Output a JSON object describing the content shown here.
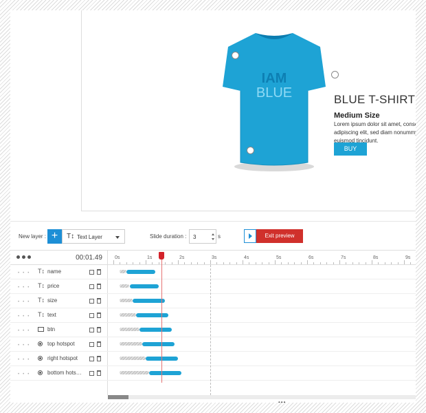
{
  "slide": {
    "shirt_text_line1": "IAM",
    "shirt_text_line2": "BLUE",
    "title": "BLUE T-SHIRT /",
    "subtitle": "Medium Size",
    "description_lines": [
      "Lorem ipsum dolor sit amet, consec",
      "adipiscing elit, sed diam nonummy",
      "euismod tincidunt."
    ],
    "button_label": "BUY"
  },
  "toolbar": {
    "new_layer_label": "New layer :",
    "add_button_glyph": "+",
    "layer_type_glyph": "T↕",
    "layer_type_value": "Text Layer",
    "slide_duration_label": "Slide duration :",
    "slide_duration_value": "3",
    "slide_duration_unit": "s",
    "exit_preview_label": "Exit preview"
  },
  "timeline": {
    "current_time": "00:01.49",
    "ticks": [
      "0s",
      "1s",
      "2s",
      "3s",
      "4s",
      "5s",
      "6s",
      "7s",
      "8s",
      "9s"
    ],
    "layers": [
      {
        "name": "name",
        "icon": "text-icon",
        "glyph": "T↕",
        "delay_s": 0.2,
        "start_s": 0.4,
        "end_s": 1.3
      },
      {
        "name": "price",
        "icon": "text-icon",
        "glyph": "T↕",
        "delay_s": 0.2,
        "start_s": 0.5,
        "end_s": 1.4
      },
      {
        "name": "size",
        "icon": "text-icon",
        "glyph": "T↕",
        "delay_s": 0.2,
        "start_s": 0.6,
        "end_s": 1.6
      },
      {
        "name": "text",
        "icon": "text-icon",
        "glyph": "T↕",
        "delay_s": 0.2,
        "start_s": 0.7,
        "end_s": 1.7
      },
      {
        "name": "btn",
        "icon": "image-icon",
        "glyph": "",
        "delay_s": 0.2,
        "start_s": 0.8,
        "end_s": 1.8
      },
      {
        "name": "top hotspot",
        "icon": "hotspot-icon",
        "glyph": "",
        "delay_s": 0.2,
        "start_s": 0.9,
        "end_s": 1.9
      },
      {
        "name": "right hotspot",
        "icon": "hotspot-icon",
        "glyph": "",
        "delay_s": 0.2,
        "start_s": 1.0,
        "end_s": 2.0
      },
      {
        "name": "bottom hots…",
        "icon": "hotspot-icon",
        "glyph": "",
        "delay_s": 0.2,
        "start_s": 1.1,
        "end_s": 2.1
      }
    ],
    "playhead_s": 1.49,
    "slide_end_s": 3
  },
  "colors": {
    "accent": "#1d8fd6",
    "bar": "#1ea3d5",
    "exit": "#d0302b",
    "playhead": "#d3222a",
    "shirt": "#1ea3d5"
  }
}
